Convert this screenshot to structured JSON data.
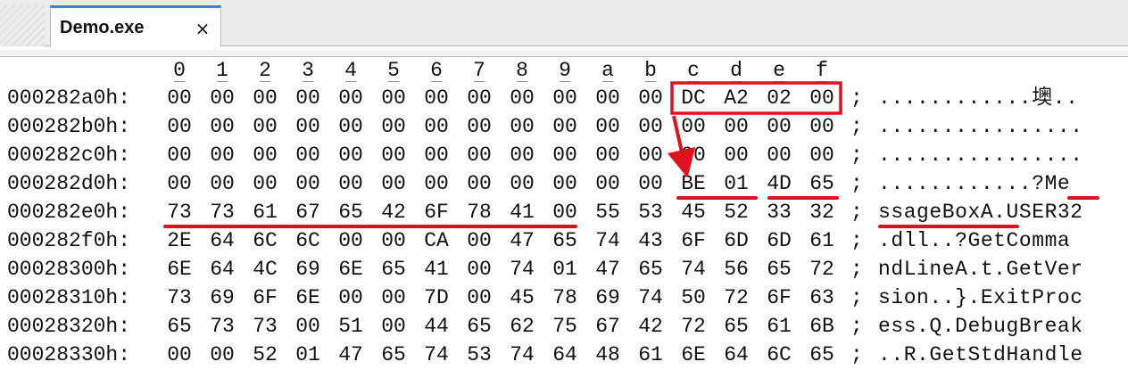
{
  "tab": {
    "title": "Demo.exe",
    "close_glyph": "×"
  },
  "column_headers": [
    "0",
    "1",
    "2",
    "3",
    "4",
    "5",
    "6",
    "7",
    "8",
    "9",
    "a",
    "b",
    "c",
    "d",
    "e",
    "f"
  ],
  "separator": ";",
  "rows": [
    {
      "address": "000282a0h:",
      "bytes": [
        "00",
        "00",
        "00",
        "00",
        "00",
        "00",
        "00",
        "00",
        "00",
        "00",
        "00",
        "00",
        "DC",
        "A2",
        "02",
        "00"
      ],
      "ascii": "............墺.."
    },
    {
      "address": "000282b0h:",
      "bytes": [
        "00",
        "00",
        "00",
        "00",
        "00",
        "00",
        "00",
        "00",
        "00",
        "00",
        "00",
        "00",
        "00",
        "00",
        "00",
        "00"
      ],
      "ascii": "................"
    },
    {
      "address": "000282c0h:",
      "bytes": [
        "00",
        "00",
        "00",
        "00",
        "00",
        "00",
        "00",
        "00",
        "00",
        "00",
        "00",
        "00",
        "00",
        "00",
        "00",
        "00"
      ],
      "ascii": "................"
    },
    {
      "address": "000282d0h:",
      "bytes": [
        "00",
        "00",
        "00",
        "00",
        "00",
        "00",
        "00",
        "00",
        "00",
        "00",
        "00",
        "00",
        "BE",
        "01",
        "4D",
        "65"
      ],
      "ascii": "............?Me"
    },
    {
      "address": "000282e0h:",
      "bytes": [
        "73",
        "73",
        "61",
        "67",
        "65",
        "42",
        "6F",
        "78",
        "41",
        "00",
        "55",
        "53",
        "45",
        "52",
        "33",
        "32"
      ],
      "ascii": "ssageBoxA.USER32"
    },
    {
      "address": "000282f0h:",
      "bytes": [
        "2E",
        "64",
        "6C",
        "6C",
        "00",
        "00",
        "CA",
        "00",
        "47",
        "65",
        "74",
        "43",
        "6F",
        "6D",
        "6D",
        "61"
      ],
      "ascii": ".dll..?GetComma"
    },
    {
      "address": "00028300h:",
      "bytes": [
        "6E",
        "64",
        "4C",
        "69",
        "6E",
        "65",
        "41",
        "00",
        "74",
        "01",
        "47",
        "65",
        "74",
        "56",
        "65",
        "72"
      ],
      "ascii": "ndLineA.t.GetVer"
    },
    {
      "address": "00028310h:",
      "bytes": [
        "73",
        "69",
        "6F",
        "6E",
        "00",
        "00",
        "7D",
        "00",
        "45",
        "78",
        "69",
        "74",
        "50",
        "72",
        "6F",
        "63"
      ],
      "ascii": "sion..}.ExitProc"
    },
    {
      "address": "00028320h:",
      "bytes": [
        "65",
        "73",
        "73",
        "00",
        "51",
        "00",
        "44",
        "65",
        "62",
        "75",
        "67",
        "42",
        "72",
        "65",
        "61",
        "6B"
      ],
      "ascii": "ess.Q.DebugBreak"
    },
    {
      "address": "00028330h:",
      "bytes": [
        "00",
        "00",
        "52",
        "01",
        "47",
        "65",
        "74",
        "53",
        "74",
        "64",
        "48",
        "61",
        "6E",
        "64",
        "6C",
        "65"
      ],
      "ascii": "..R.GetStdHandle"
    }
  ],
  "colors": {
    "annotation_red": "#e0101e",
    "tab_accent": "#3c7fd8",
    "text": "#111111"
  }
}
